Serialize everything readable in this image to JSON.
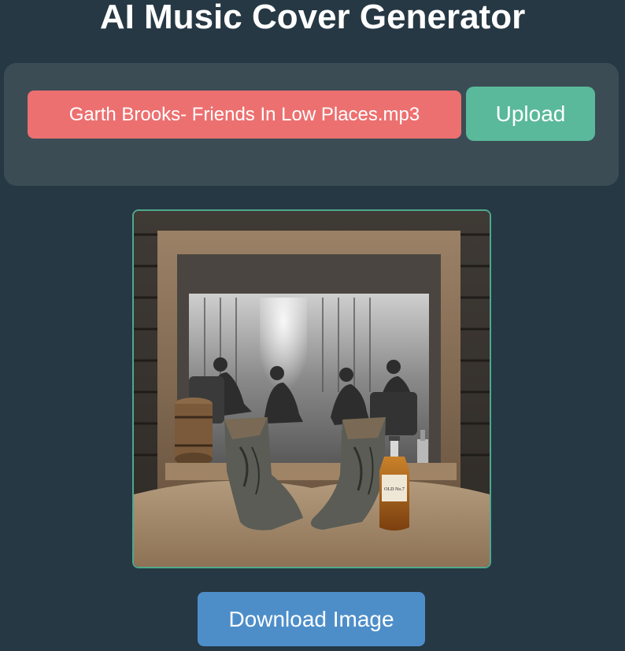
{
  "header": {
    "title": "AI Music Cover Generator"
  },
  "upload": {
    "file_name": "Garth Brooks- Friends In Low Places.mp3",
    "upload_label": "Upload"
  },
  "cover": {
    "bottle_label": "OLD No.7"
  },
  "actions": {
    "download_label": "Download Image"
  },
  "colors": {
    "background": "#263844",
    "panel": "#3b4c55",
    "file_chip": "#ed7070",
    "upload_button": "#5ab99a",
    "download_button": "#4d8ec9",
    "image_border": "#4fa88c"
  }
}
